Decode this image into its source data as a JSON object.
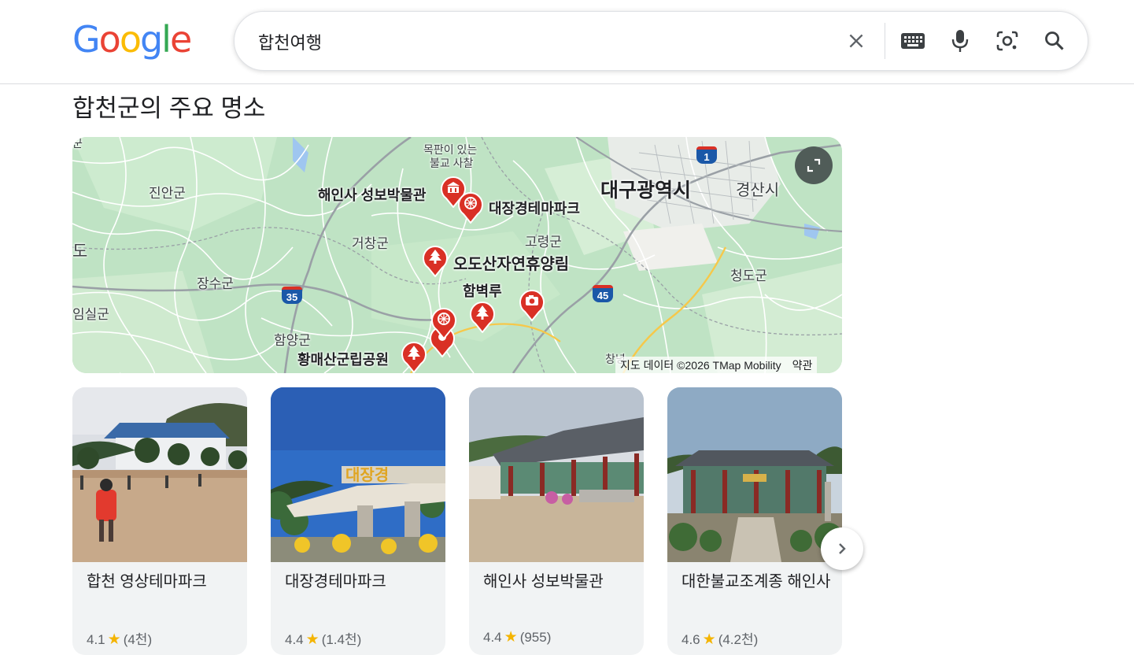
{
  "search": {
    "query": "합천여행"
  },
  "logo": {
    "letters": [
      "G",
      "o",
      "o",
      "g",
      "l",
      "e"
    ],
    "colors": [
      "#4285F4",
      "#EA4335",
      "#FBBC05",
      "#4285F4",
      "#34A853",
      "#EA4335"
    ]
  },
  "section": {
    "title": "합천군의 주요 명소"
  },
  "map": {
    "labels": {
      "top1": "목판이 있는",
      "top2": "불교 사찰",
      "jinan": "진안군",
      "museum": "해인사 성보박물관",
      "themepark": "대장경테마파크",
      "daegu": "대구광역시",
      "gyeongsan": "경산시",
      "geochang": "거창군",
      "goryeong": "고령군",
      "do": "도",
      "ododsan": "오도산자연휴양림",
      "cheongdo": "청도군",
      "jangsu": "장수군",
      "hambyeokru": "함벽루",
      "imsil": "임실군",
      "hamyang": "함양군",
      "hwangmaesan": "황매산군립공원",
      "chang": "창녕",
      "gun_top_left": "군"
    },
    "highways": {
      "h1": "1",
      "h35": "35",
      "h45": "45"
    },
    "attribution": "지도 데이터 ©2026 TMap Mobility",
    "terms": "약관"
  },
  "places": [
    {
      "name": "합천 영상테마파크",
      "rating": "4.1",
      "reviews": "(4천)"
    },
    {
      "name": "대장경테마파크",
      "rating": "4.4",
      "reviews": "(1.4천)"
    },
    {
      "name": "해인사 성보박물관",
      "rating": "4.4",
      "reviews": "(955)"
    },
    {
      "name": "대한불교조계종 해인사",
      "rating": "4.6",
      "reviews": "(4.2천)"
    }
  ],
  "icons": [
    "clear-icon",
    "keyboard-icon",
    "mic-icon",
    "lens-icon",
    "search-icon",
    "expand-icon",
    "chevron-right-icon",
    "star-icon",
    "museum-pin-icon",
    "theme-park-pin-icon",
    "tree-pin-icon",
    "camera-pin-icon"
  ]
}
